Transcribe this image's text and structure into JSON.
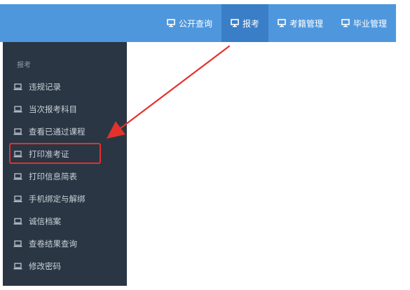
{
  "topnav": {
    "items": [
      {
        "label": "公开查询"
      },
      {
        "label": "报考"
      },
      {
        "label": "考籍管理"
      },
      {
        "label": "毕业管理"
      }
    ]
  },
  "sidebar": {
    "section_title": "报考",
    "items": [
      {
        "label": "违规记录"
      },
      {
        "label": "当次报考科目"
      },
      {
        "label": "查看已通过课程"
      },
      {
        "label": "打印准考证"
      },
      {
        "label": "打印信息简表"
      },
      {
        "label": "手机绑定与解绑"
      },
      {
        "label": "诚信档案"
      },
      {
        "label": "查卷结果查询"
      },
      {
        "label": "修改密码"
      }
    ]
  },
  "annotation": {
    "color": "#e3312c"
  }
}
